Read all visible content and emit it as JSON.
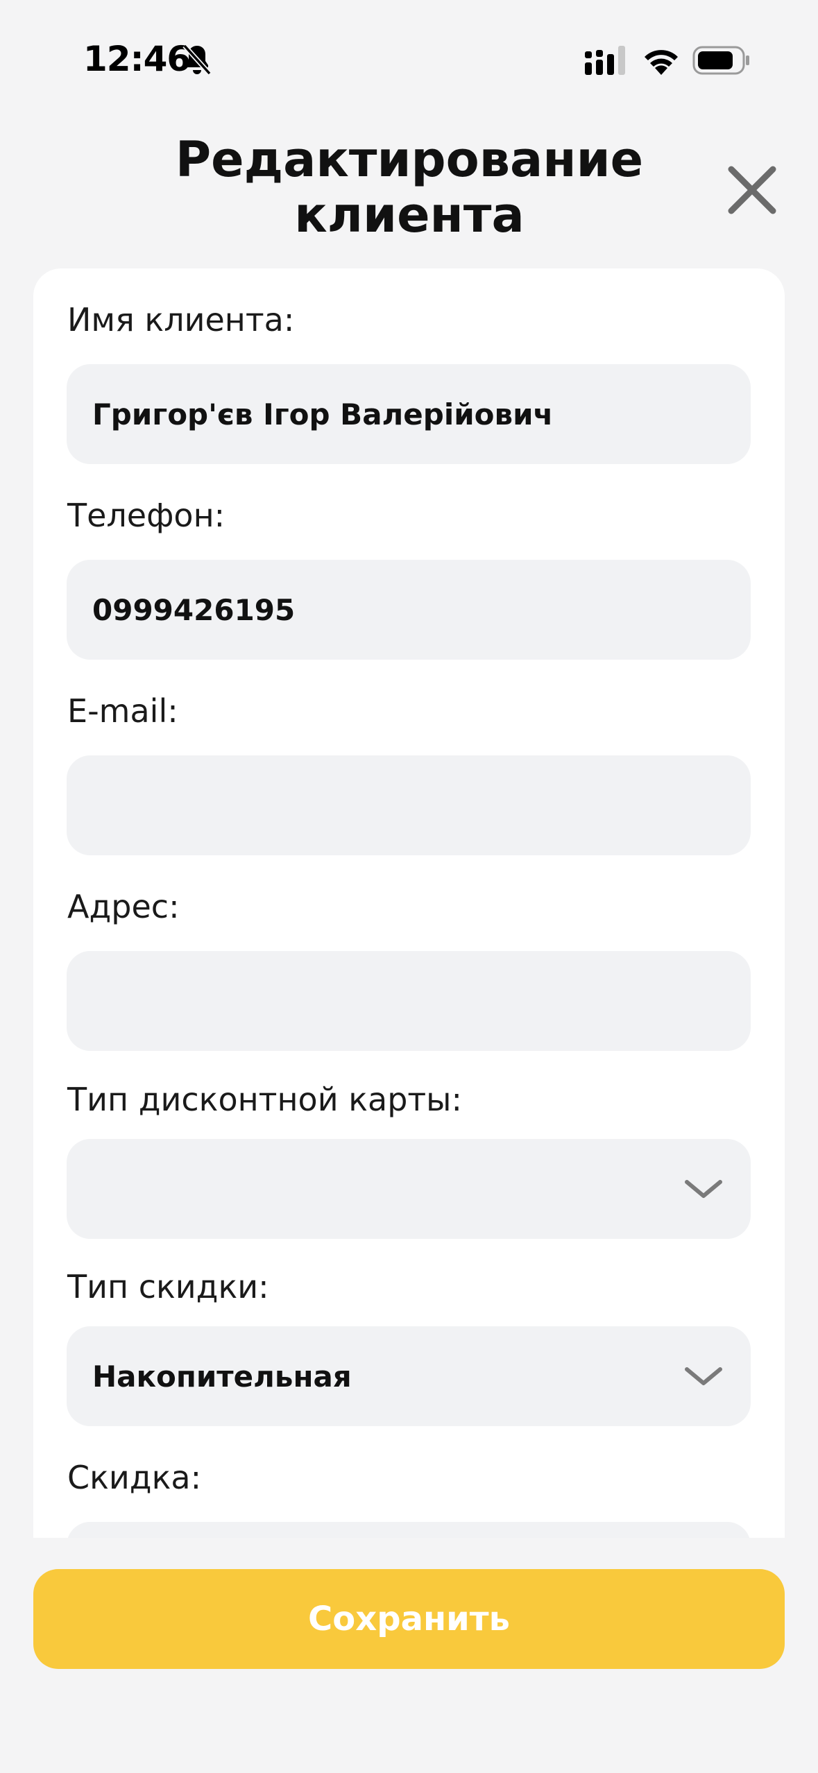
{
  "status_bar": {
    "time": "12:46",
    "icons": [
      "bell-slash-icon",
      "signal-icon",
      "wifi-icon",
      "battery-icon"
    ]
  },
  "header": {
    "title_line1": "Редактирование",
    "title_line2": "клиента",
    "close_icon": "close-icon"
  },
  "form": {
    "fields": [
      {
        "label": "Имя клиента:",
        "value": "Григор'єв Ігор Валерійович",
        "type": "text"
      },
      {
        "label": "Телефон:",
        "value": "0999426195",
        "type": "text"
      },
      {
        "label": "E-mail:",
        "value": "",
        "type": "text"
      },
      {
        "label": "Адрес:",
        "value": "",
        "type": "text"
      },
      {
        "label": "Тип дисконтной карты:",
        "value": "",
        "type": "select"
      },
      {
        "label": "Тип скидки:",
        "value": "Накопительная",
        "type": "select"
      },
      {
        "label": "Скидка:",
        "value": "",
        "type": "text"
      }
    ]
  },
  "actions": {
    "save_label": "Сохранить"
  },
  "colors": {
    "background": "#f4f4f5",
    "card": "#ffffff",
    "input": "#f1f2f4",
    "accent": "#f9c93c"
  }
}
